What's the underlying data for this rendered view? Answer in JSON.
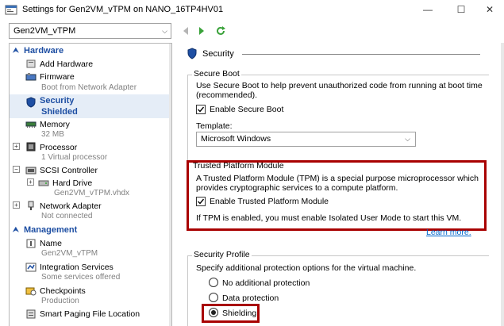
{
  "window": {
    "title": "Settings for Gen2VM_vTPM on NANO_16TP4HV01",
    "minimize_glyph": "—",
    "maximize_glyph": "☐",
    "close_glyph": "✕"
  },
  "toolbar": {
    "vm_select_value": "Gen2VM_vTPM"
  },
  "sidebar": {
    "hardware_label": "Hardware",
    "management_label": "Management",
    "items": [
      {
        "name": "Add Hardware",
        "sub": "",
        "icon": "add-hardware-icon"
      },
      {
        "name": "Firmware",
        "sub": "Boot from Network Adapter",
        "icon": "firmware-icon"
      },
      {
        "name": "Security",
        "sub": "Shielded",
        "icon": "shield-icon"
      },
      {
        "name": "Memory",
        "sub": "32 MB",
        "icon": "memory-icon"
      },
      {
        "name": "Processor",
        "sub": "1 Virtual processor",
        "icon": "processor-icon"
      },
      {
        "name": "SCSI Controller",
        "sub": "",
        "icon": "scsi-controller-icon"
      },
      {
        "name": "Hard Drive",
        "sub": "Gen2VM_vTPM.vhdx",
        "icon": "hard-drive-icon"
      },
      {
        "name": "Network Adapter",
        "sub": "Not connected",
        "icon": "network-adapter-icon"
      }
    ],
    "mgmt_items": [
      {
        "name": "Name",
        "sub": "Gen2VM_vTPM",
        "icon": "name-icon"
      },
      {
        "name": "Integration Services",
        "sub": "Some services offered",
        "icon": "integration-services-icon"
      },
      {
        "name": "Checkpoints",
        "sub": "Production",
        "icon": "checkpoints-icon"
      },
      {
        "name": "Smart Paging File Location",
        "sub": "",
        "icon": "smart-paging-icon"
      }
    ]
  },
  "main": {
    "header": "Security",
    "secure_boot": {
      "label": "Secure Boot",
      "description_line1": "Use Secure Boot to help prevent unauthorized code from running at boot time",
      "description_line2": "(recommended).",
      "enable_label": "Enable Secure Boot",
      "enabled": true,
      "template_label": "Template:",
      "template_value": "Microsoft Windows"
    },
    "tpm": {
      "label": "Trusted Platform Module",
      "description_line1": "A Trusted Platform Module (TPM) is a special purpose microprocessor which",
      "description_line2": "provides cryptographic services to a compute platform.",
      "enable_label": "Enable Trusted Platform Module",
      "enabled": true,
      "note": "If TPM is enabled, you must enable Isolated User Mode to start this VM.",
      "learn_more": "Learn more."
    },
    "security_profile": {
      "label": "Security Profile",
      "description": "Specify additional protection options for the virtual machine.",
      "options": [
        "No additional protection",
        "Data protection",
        "Shielding"
      ],
      "selected": "Shielding"
    }
  },
  "colors": {
    "accent": "#1e4fa3",
    "highlight_box": "#a80000",
    "selection_bg": "#e5edf7",
    "link": "#0066cc",
    "sub_text": "#808080"
  }
}
